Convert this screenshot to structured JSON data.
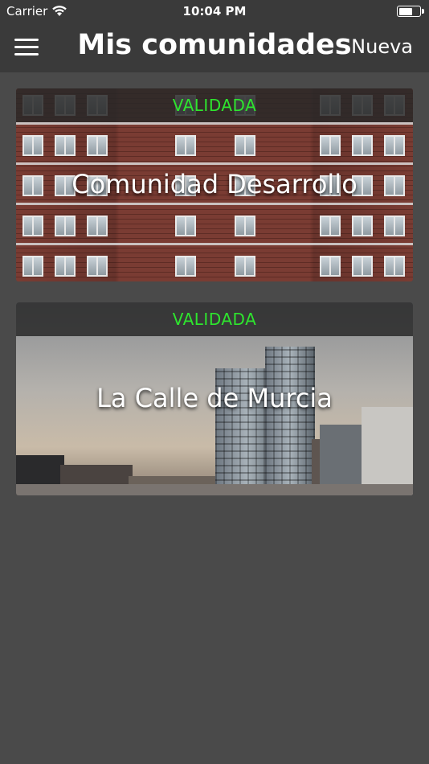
{
  "status_bar": {
    "carrier": "Carrier",
    "time": "10:04 PM",
    "battery_level": 0.65
  },
  "nav": {
    "title": "Mis comunidades",
    "action_label": "Nueva",
    "menu_icon": "hamburger-menu-icon"
  },
  "communities": [
    {
      "status": "VALIDADA",
      "name": "Comunidad Desarrollo",
      "image": "brick-apartment-building"
    },
    {
      "status": "VALIDADA",
      "name": "La Calle de Murcia",
      "image": "city-skyline"
    }
  ],
  "colors": {
    "background": "#4a4a4a",
    "bar": "#3a3a3a",
    "status_validated": "#2ee52e",
    "text": "#ffffff"
  }
}
